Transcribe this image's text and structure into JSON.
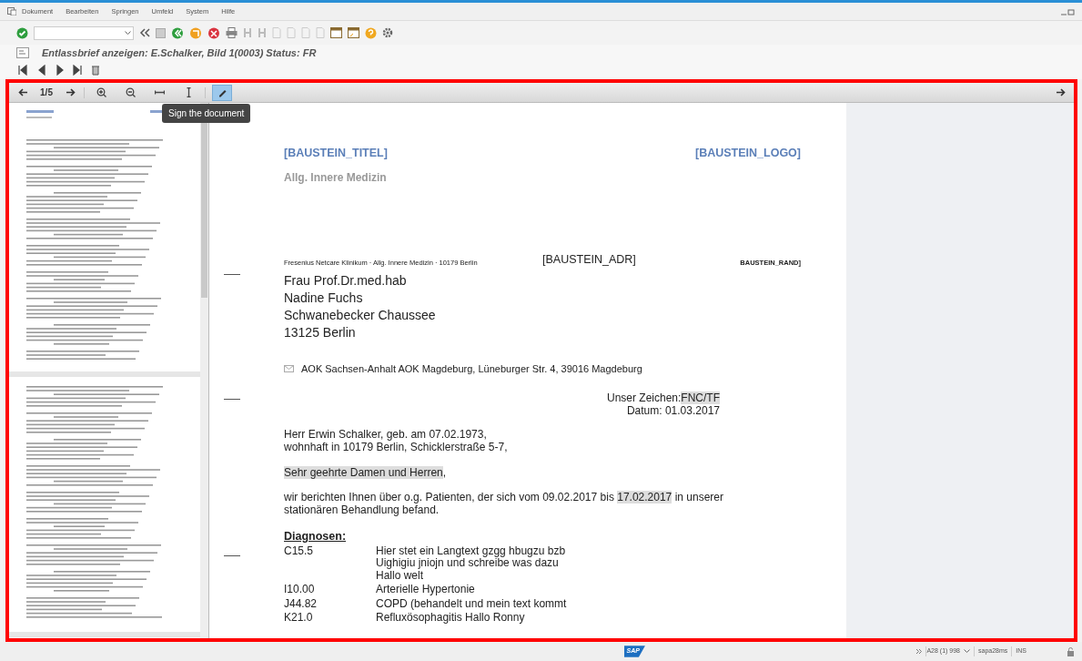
{
  "menu": [
    {
      "label": "Dokument"
    },
    {
      "label": "Bearbeiten"
    },
    {
      "label": "Springen"
    },
    {
      "label": "Umfeld"
    },
    {
      "label": "System"
    },
    {
      "label": "Hilfe"
    }
  ],
  "title": "Entlassbrief anzeigen: E.Schalker, Bild 1(0003) Status: FR",
  "viewer": {
    "page_indicator": "1/5",
    "tools": [
      {
        "kind": "zoom-in",
        "selected": false
      },
      {
        "kind": "zoom-out",
        "selected": false
      },
      {
        "kind": "fit-width",
        "selected": false
      },
      {
        "kind": "fit-height",
        "selected": false
      },
      {
        "kind": "sign",
        "selected": true
      }
    ],
    "tooltip": "Sign the document"
  },
  "document": {
    "title_block": "[BAUSTEIN_TITEL]",
    "logo_block": "[BAUSTEIN_LOGO]",
    "department": "Allg. Innere Medizin",
    "sender_line": "Fresenius Netcare Klinikum · Allg. Innere Medizin · 10179 Berlin",
    "address_block": "[BAUSTEIN_ADR]",
    "margin_block": "BAUSTEIN_RAND]",
    "recipient": [
      "Frau Prof.Dr.med.hab",
      "Nadine Fuchs",
      "Schwanebecker Chaussee",
      "13125 Berlin"
    ],
    "insurance": "AOK Sachsen-Anhalt AOK Magdeburg, Lüneburger Str. 4, 39016 Magdeburg",
    "reference": [
      {
        "text": "Unser Zeichen:",
        "highlighted": false
      },
      {
        "text": "FNC/TF",
        "highlighted": true
      }
    ],
    "date": "Datum: 01.03.2017",
    "patient": [
      "Herr Erwin Schalker, geb. am 07.02.1973,",
      "wohnhaft in 10179 Berlin, Schicklerstraße 5-7,"
    ],
    "salutation": [
      {
        "text": "Sehr geehrte Damen und Herren",
        "highlighted": true
      },
      {
        "text": ",",
        "highlighted": false
      }
    ],
    "intro": [
      {
        "text": "wir berichten Ihnen über o.g. Patienten, der sich vom 09.02.2017 bis ",
        "highlighted": false
      },
      {
        "text": "17.02.2017",
        "highlighted": true
      },
      {
        "text": " in unserer stationären Behandlung befand.",
        "highlighted": false
      }
    ],
    "diagnoses_heading": "Diagnosen:",
    "diagnoses": [
      {
        "code": "C15.5",
        "lines": [
          "Hier stet ein Langtext gzgg hbugzu bzb",
          "Uighigiu jniojn und schreibe was dazu",
          "Hallo welt"
        ]
      },
      {
        "code": "I10.00",
        "lines": [
          "Arterielle Hypertonie"
        ]
      },
      {
        "code": "J44.82",
        "lines": [
          "COPD (behandelt und mein text kommt"
        ]
      },
      {
        "code": "K21.0",
        "lines": [
          "Refluxösophagitis Hallo Ronny"
        ]
      }
    ]
  },
  "status_bar": {
    "logo": "SAP",
    "system": "A28 (1) 998",
    "server": "sapa28ms",
    "mode": "INS"
  }
}
